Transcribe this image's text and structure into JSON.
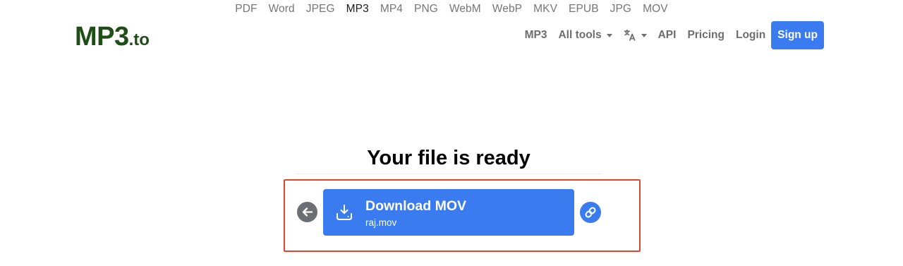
{
  "formats": [
    "PDF",
    "Word",
    "JPEG",
    "MP3",
    "MP4",
    "PNG",
    "WebM",
    "WebP",
    "MKV",
    "EPUB",
    "JPG",
    "MOV"
  ],
  "active_format_index": 3,
  "logo": {
    "main": "MP3",
    "tld": ".to"
  },
  "nav": {
    "mp3": "MP3",
    "all_tools": "All tools",
    "language_icon": "translate-icon",
    "api": "API",
    "pricing": "Pricing",
    "login": "Login",
    "signup": "Sign up"
  },
  "main": {
    "heading": "Your file is ready",
    "download_label": "Download MOV",
    "file_name": "raj.mov"
  },
  "colors": {
    "brand_green": "#1f4d18",
    "primary_blue": "#3a7bf0",
    "highlight_red": "#e0472a",
    "back_gray": "#6b6f73"
  }
}
